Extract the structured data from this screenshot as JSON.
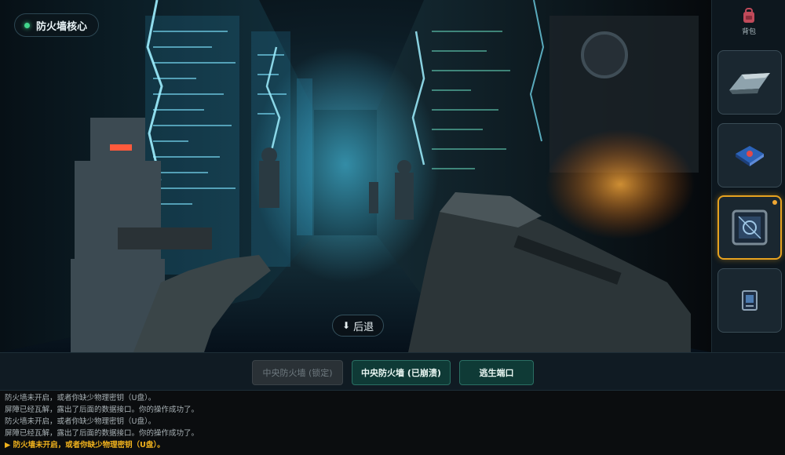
{
  "location": {
    "title": "防火墙核心"
  },
  "scene": {
    "back_label": "后退"
  },
  "inventory": {
    "backpack_label": "背包",
    "slots": [
      {
        "item": "data-shard-icon",
        "selected": false
      },
      {
        "item": "chip-card-icon",
        "selected": false
      },
      {
        "item": "firewall-module-icon",
        "selected": true
      },
      {
        "item": "keycard-icon",
        "selected": false
      }
    ]
  },
  "actions": [
    {
      "label": "中央防火墙 (锁定)",
      "state": "disabled"
    },
    {
      "label": "中央防火墙 (已崩溃)",
      "state": "active"
    },
    {
      "label": "逃生端口",
      "state": "active"
    }
  ],
  "log": {
    "lines": [
      "防火墙未开启，或者你缺少物理密钥（U盘）。",
      "屏障已经瓦解，露出了后面的数据接口。你的操作成功了。",
      "防火墙未开启，或者你缺少物理密钥（U盘）。",
      "屏障已经瓦解，露出了后面的数据接口。你的操作成功了。"
    ],
    "latest": "▶ 防火墙未开启，或者你缺少物理密钥（U盘）。"
  },
  "colors": {
    "accent": "#e6a21f",
    "status_online": "#41d68c",
    "log_highlight": "#f0b21d"
  }
}
